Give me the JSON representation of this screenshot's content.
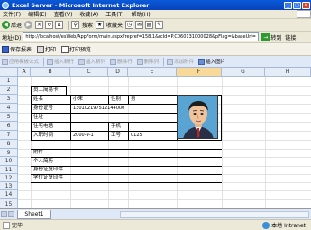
{
  "window": {
    "title": "Excel Server - Microsoft Internet Explorer"
  },
  "menu": [
    "文件(F)",
    "编辑(E)",
    "查看(V)",
    "收藏(A)",
    "工具(T)",
    "帮助(H)"
  ],
  "nav": {
    "back": "后退",
    "search": "搜索",
    "favorites": "收藏夹"
  },
  "address": {
    "label": "地址(D)",
    "url": "http://localhost/esWeb/AppForm/main.aspx?repref=158.1&rcId=P.C060131000028&pFlag=&baseUrl=",
    "go": "转到",
    "links": "链接"
  },
  "app_toolbar": {
    "save": "保存报表",
    "print": "打印",
    "preview": "打印预览"
  },
  "format_toolbar": [
    "应用模板公式",
    "插入新行",
    "插入新列",
    "删除行",
    "删除列",
    "添加附件",
    "插入图片"
  ],
  "sheet": {
    "columns": [
      "A",
      "B",
      "C",
      "D",
      "E",
      "F",
      "G",
      "H"
    ],
    "rows": [
      "1",
      "2",
      "3",
      "4",
      "5",
      "6",
      "7",
      "8",
      "9",
      "10",
      "11",
      "12",
      "13",
      "14",
      "15"
    ],
    "card_title": "员工简易卡",
    "name_label": "姓名",
    "name_value": "小宋",
    "gender_label": "性别",
    "gender_value": "男",
    "id_label": "身份证号",
    "id_value": "130102197512144000",
    "address_label": "住址",
    "phone_label": "住宅电话",
    "mobile_label": "手机",
    "hire_label": "入职时间",
    "hire_value": "2000-9-1",
    "empno_label": "工号",
    "empno_value": "0125",
    "attachments_label": "附件",
    "attachments": [
      "个人简历",
      "身份证复印件",
      "学位证复印件"
    ],
    "tab": "Sheet1"
  },
  "status": {
    "left": "完毕",
    "zone": "本地 Intranet"
  },
  "colors": {
    "title_bar": "#0a5ad9",
    "header": "#e4ecf7",
    "selected_header": "#f9d99a",
    "photo_bg": "#5aa4d4"
  }
}
